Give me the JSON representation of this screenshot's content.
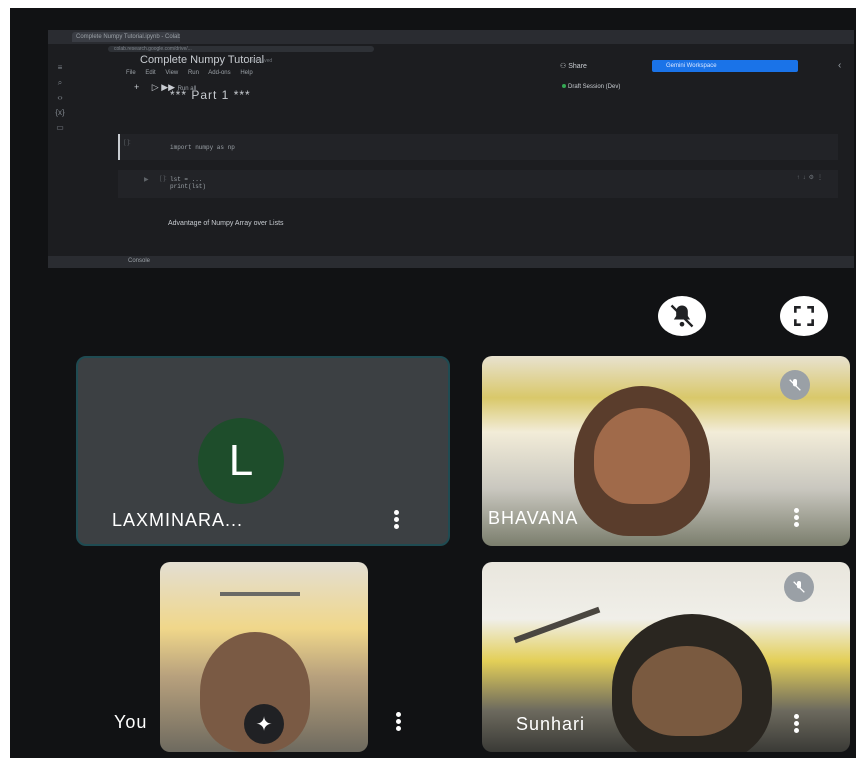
{
  "browser": {
    "tab_title": "Complete Numpy Tutorial.ipynb - Colaboratory",
    "url": "colab.research.google.com/drive/..."
  },
  "notebook": {
    "title": "Complete Numpy Tutorial",
    "subtitle": "Last saved",
    "menu": [
      "File",
      "Edit",
      "View",
      "Run",
      "Add-ons",
      "Help"
    ],
    "share_label": "Share",
    "blue_button": "Gemini Workspace",
    "toolbar_run_all": "Run all",
    "draft_label": "Draft Session (Dev)",
    "heading": "*** Part 1 ***",
    "cells": [
      {
        "num": "[ ]:",
        "code": "import numpy as np"
      },
      {
        "num": "[ ]:",
        "code": "lst = ...\nprint(lst)"
      }
    ],
    "markdown": "Advantage of Numpy Array over Lists",
    "bottom_bar": "Console"
  },
  "controls": {
    "pin_off": "bell-off-icon",
    "fullscreen": "fullscreen-icon"
  },
  "participants": [
    {
      "name": "LAXMINARA...",
      "initial": "L",
      "camera": false
    },
    {
      "name": "BHAVANA",
      "camera": true,
      "muted": true
    },
    {
      "name": "You",
      "camera": true,
      "muted": true
    },
    {
      "name": "Sunhari",
      "camera": true,
      "muted": true
    }
  ],
  "colors": {
    "background": "#111214",
    "tile_dark": "#3c4043",
    "avatar": "#1e4d2b",
    "accent": "#1a73e8"
  }
}
